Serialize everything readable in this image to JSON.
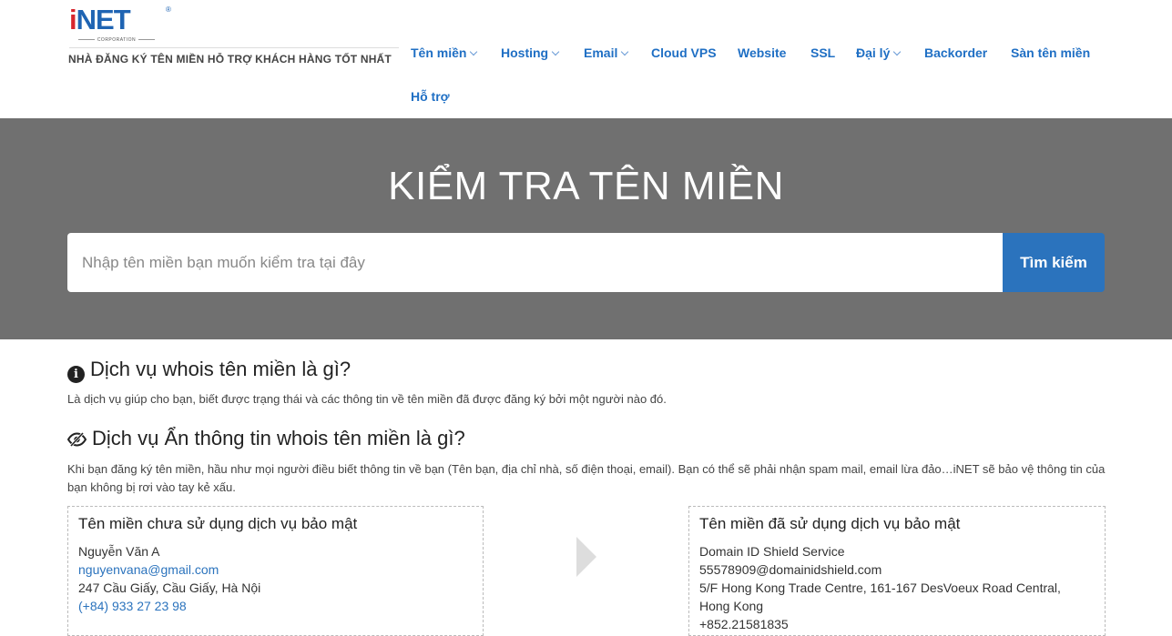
{
  "header": {
    "logo_text_i": "i",
    "logo_text_rest": "NET",
    "logo_reg": "®",
    "logo_corp": "CORPORATION",
    "tagline": "NHÀ ĐĂNG KÝ TÊN MIỀN HỖ TRỢ KHÁCH HÀNG TỐT NHẤT"
  },
  "nav": {
    "items": [
      {
        "label": "Tên miền",
        "dropdown": true
      },
      {
        "label": "Hosting",
        "dropdown": true
      },
      {
        "label": "Email",
        "dropdown": true
      },
      {
        "label": "Cloud VPS",
        "dropdown": false
      },
      {
        "label": "Website",
        "dropdown": false
      },
      {
        "label": "SSL",
        "dropdown": false
      },
      {
        "label": "Đại lý",
        "dropdown": true
      },
      {
        "label": "Backorder",
        "dropdown": false
      },
      {
        "label": "Sàn tên miền",
        "dropdown": false
      },
      {
        "label": "Hỗ trợ",
        "dropdown": false
      }
    ]
  },
  "hero": {
    "title": "KIỂM TRA TÊN MIỀN",
    "search_placeholder": "Nhập tên miền bạn muốn kiểm tra tại đây",
    "search_button": "Tìm kiếm"
  },
  "sections": {
    "whois_title": "Dịch vụ whois tên miền là gì?",
    "whois_text": "Là dịch vụ giúp cho bạn, biết được trạng thái và các thông tin về tên miền đã được đăng ký bởi một người nào đó.",
    "privacy_title": "Dịch vụ Ẩn thông tin whois tên miền là gì?",
    "privacy_text": "Khi bạn đăng ký tên miền, hầu như mọi người điều biết thông tin về bạn (Tên bạn, địa chỉ nhà, số điện thoại, email). Bạn có thể sẽ phải nhận spam mail, email lừa đảo…iNET sẽ bảo vệ thông tin của bạn không bị rơi vào tay kẻ xấu."
  },
  "compare": {
    "left": {
      "title": "Tên miền chưa sử dụng dịch vụ bảo mật",
      "name": "Nguyễn Văn A",
      "email": "nguyenvana@gmail.com",
      "address": "247 Cầu Giấy, Cầu Giấy, Hà Nội",
      "phone": "(+84) 933 27 23 98"
    },
    "right": {
      "title": "Tên miền đã sử dụng dịch vụ bảo mật",
      "name": "Domain ID Shield Service",
      "email": "55578909@domainidshield.com",
      "address_line1": "5/F Hong Kong Trade Centre, 161-167 DesVoeux Road Central,",
      "address_line2": "Hong Kong",
      "phone": "+852.21581835"
    }
  },
  "colors": {
    "brand_blue": "#1f64b3",
    "brand_red": "#d7262e",
    "nav_blue": "#1f6fc4",
    "hero_bg": "#707070",
    "button_blue": "#2b73bd"
  }
}
